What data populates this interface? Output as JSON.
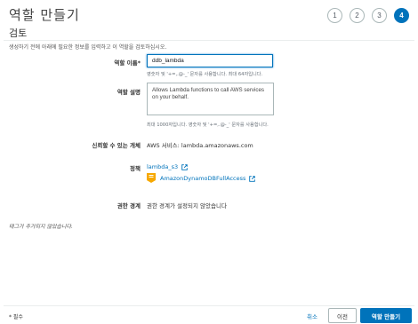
{
  "header": {
    "title": "역할 만들기",
    "steps": [
      "1",
      "2",
      "3",
      "4"
    ],
    "active_step": "4"
  },
  "section": {
    "title": "검토",
    "subtitle": "생성하기 전에 아래에 필요한 정보를 입력하고 이 역할을 검토하십시오."
  },
  "role_name": {
    "label": "역할 이름*",
    "value": "ddb_lambda",
    "hint": "영숫자 및 '+=,.@-_' 문자를 사용합니다. 최대 64자입니다."
  },
  "role_description": {
    "label": "역할 설명",
    "value": "Allows Lambda functions to call AWS services on your behalf.",
    "hint": "최대 1000자입니다. 영숫자 및 '+=,.@-_' 문자를 사용합니다."
  },
  "trusted_entity": {
    "label": "신뢰할 수 있는 개체",
    "value": "AWS 서비스: lambda.amazonaws.com"
  },
  "policies": {
    "label": "정책",
    "items": [
      "lambda_s3",
      "AmazonDynamoDBFullAccess"
    ]
  },
  "permissions_boundary": {
    "label": "권한 경계",
    "value": "권한 경계가 설정되지 않았습니다"
  },
  "tags": {
    "note": "태그가 추가되지 않았습니다."
  },
  "footer": {
    "required_note": "* 필수",
    "cancel_label": "취소",
    "previous_label": "이전",
    "create_label": "역할 만들기"
  },
  "colors": {
    "accent": "#0073bb",
    "policy_icon": "#f7a800",
    "border": "#aab7b8"
  }
}
